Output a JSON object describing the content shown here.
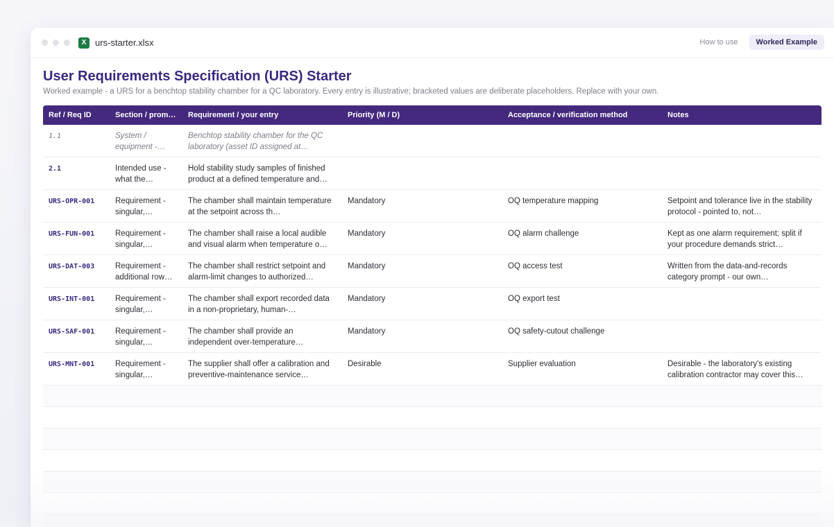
{
  "window": {
    "file_icon": "X",
    "file_name": "urs-starter.xlsx",
    "tabs": [
      {
        "label": "How to use",
        "active": false
      },
      {
        "label": "Worked Example",
        "active": true
      }
    ]
  },
  "page": {
    "title": "User Requirements Specification (URS) Starter",
    "subtitle": "Worked example - a URS for a benchtop stability chamber for a QC laboratory. Every entry is illustrative; bracketed values are deliberate placeholders. Replace with your own."
  },
  "table": {
    "headers": [
      "Ref / Req ID",
      "Section / prom…",
      "Requirement / your entry",
      "Priority (M / D)",
      "Acceptance / verification method",
      "Notes"
    ],
    "rows": [
      {
        "ref": "1.1",
        "section": "System / equipment -…",
        "requirement": "Benchtop stability chamber for the QC laboratory (asset ID assigned at…",
        "priority": "",
        "acceptance": "",
        "notes": "",
        "italic": true
      },
      {
        "ref": "2.1",
        "section": "Intended use - what the…",
        "requirement": "Hold stability study samples of finished product at a defined temperature and…",
        "priority": "",
        "acceptance": "",
        "notes": "",
        "italic": false
      },
      {
        "ref": "URS-OPR-001",
        "section": "Requirement - singular,…",
        "requirement": "The chamber shall maintain temperature at the setpoint across th…",
        "priority": "Mandatory",
        "acceptance": "OQ temperature mapping",
        "notes": "Setpoint and tolerance live in the stability protocol - pointed to, not…",
        "italic": false
      },
      {
        "ref": "URS-FUN-001",
        "section": "Requirement - singular,…",
        "requirement": "The chamber shall raise a local audible and visual alarm when temperature o…",
        "priority": "Mandatory",
        "acceptance": "OQ alarm challenge",
        "notes": "Kept as one alarm requirement; split if your procedure demands strict…",
        "italic": false
      },
      {
        "ref": "URS-DAT-003",
        "section": "Requirement - additional row…",
        "requirement": "The chamber shall restrict setpoint and alarm-limit changes to authorized…",
        "priority": "Mandatory",
        "acceptance": "OQ access test",
        "notes": "Written from the data-and-records category prompt - our own…",
        "italic": false
      },
      {
        "ref": "URS-INT-001",
        "section": "Requirement - singular,…",
        "requirement": "The chamber shall export recorded data in a non-proprietary, human-…",
        "priority": "Mandatory",
        "acceptance": "OQ export test",
        "notes": "",
        "italic": false
      },
      {
        "ref": "URS-SAF-001",
        "section": "Requirement - singular,…",
        "requirement": "The chamber shall provide an independent over-temperature…",
        "priority": "Mandatory",
        "acceptance": "OQ safety-cutout challenge",
        "notes": "",
        "italic": false
      },
      {
        "ref": "URS-MNT-001",
        "section": "Requirement - singular,…",
        "requirement": "The supplier shall offer a calibration and preventive-maintenance service…",
        "priority": "Desirable",
        "acceptance": "Supplier evaluation",
        "notes": "Desirable - the laboratory's existing calibration contractor may cover this…",
        "italic": false
      }
    ],
    "empty_rows": 7
  }
}
